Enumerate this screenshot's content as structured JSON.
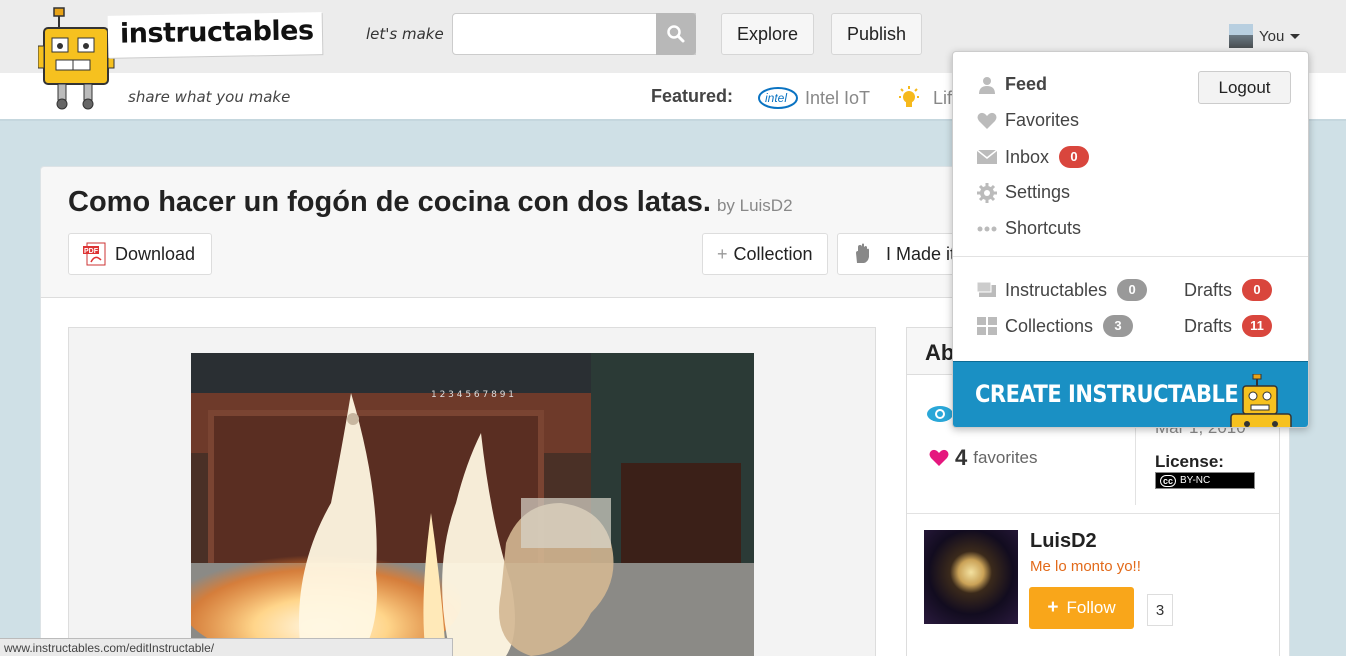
{
  "header": {
    "logo_text": "instructables",
    "tagline": "share what you make",
    "lets_make": "let's make",
    "search_placeholder": "",
    "explore_label": "Explore",
    "publish_label": "Publish",
    "user_label": "You"
  },
  "subnav": {
    "featured_label": "Featured:",
    "items": [
      {
        "label": "Intel IoT",
        "icon": "intel-icon"
      },
      {
        "label": "Lif",
        "icon": "lightbulb-icon"
      }
    ]
  },
  "article": {
    "title": "Como hacer un fogón de cocina con dos latas.",
    "by": "by LuisD2",
    "download_label": "Download",
    "collection_label": "Collection",
    "imadeit_label": "I Made it!"
  },
  "aside": {
    "title": "Ab",
    "favorites_count": "4",
    "favorites_label": "favorites",
    "date": "Mar 1, 2010",
    "license_label": "License:",
    "license_badge": "BY-NC"
  },
  "author": {
    "name": "LuisD2",
    "tagline": "Me lo monto yo!!",
    "follow_label": "Follow",
    "follower_count": "3"
  },
  "dropdown": {
    "logout_label": "Logout",
    "items": [
      {
        "label": "Feed",
        "icon": "person-icon"
      },
      {
        "label": "Favorites",
        "icon": "heart-icon"
      },
      {
        "label": "Inbox",
        "icon": "envelope-icon",
        "badge": "0"
      },
      {
        "label": "Settings",
        "icon": "gear-icon"
      },
      {
        "label": "Shortcuts",
        "icon": "dots-icon"
      }
    ],
    "stats": {
      "instructables_label": "Instructables",
      "instructables_count": "0",
      "drafts1_label": "Drafts",
      "drafts1_count": "0",
      "collections_label": "Collections",
      "collections_count": "3",
      "drafts2_label": "Drafts",
      "drafts2_count": "11"
    },
    "create_label": "CREATE INSTRUCTABLE »"
  },
  "statusbar": {
    "url": "www.instructables.com/editInstructable/"
  },
  "colors": {
    "accent_orange": "#f9a61a",
    "create_blue": "#1a90c4",
    "badge_red": "#d9463d",
    "badge_grey": "#999999",
    "robot_yellow": "#f6c11f"
  }
}
